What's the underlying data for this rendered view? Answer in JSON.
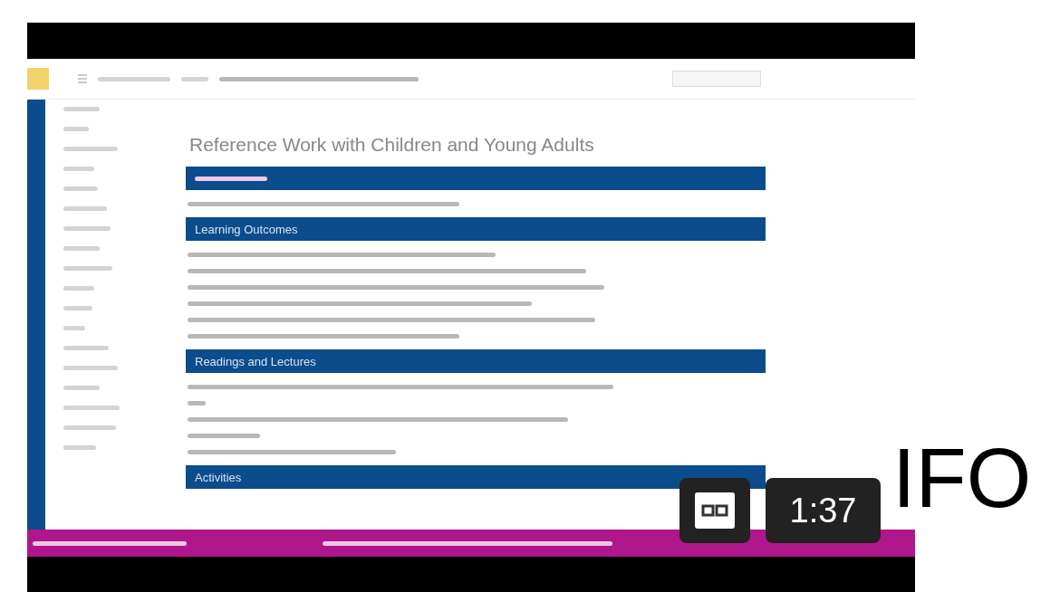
{
  "video": {
    "page_title": "Reference Work with Children and Young Adults",
    "sections": [
      {
        "heading": "Learning Outcomes"
      },
      {
        "heading": "Readings and Lectures"
      },
      {
        "heading": "Activities"
      }
    ],
    "duration": "1:37"
  },
  "side_text": "IFO"
}
